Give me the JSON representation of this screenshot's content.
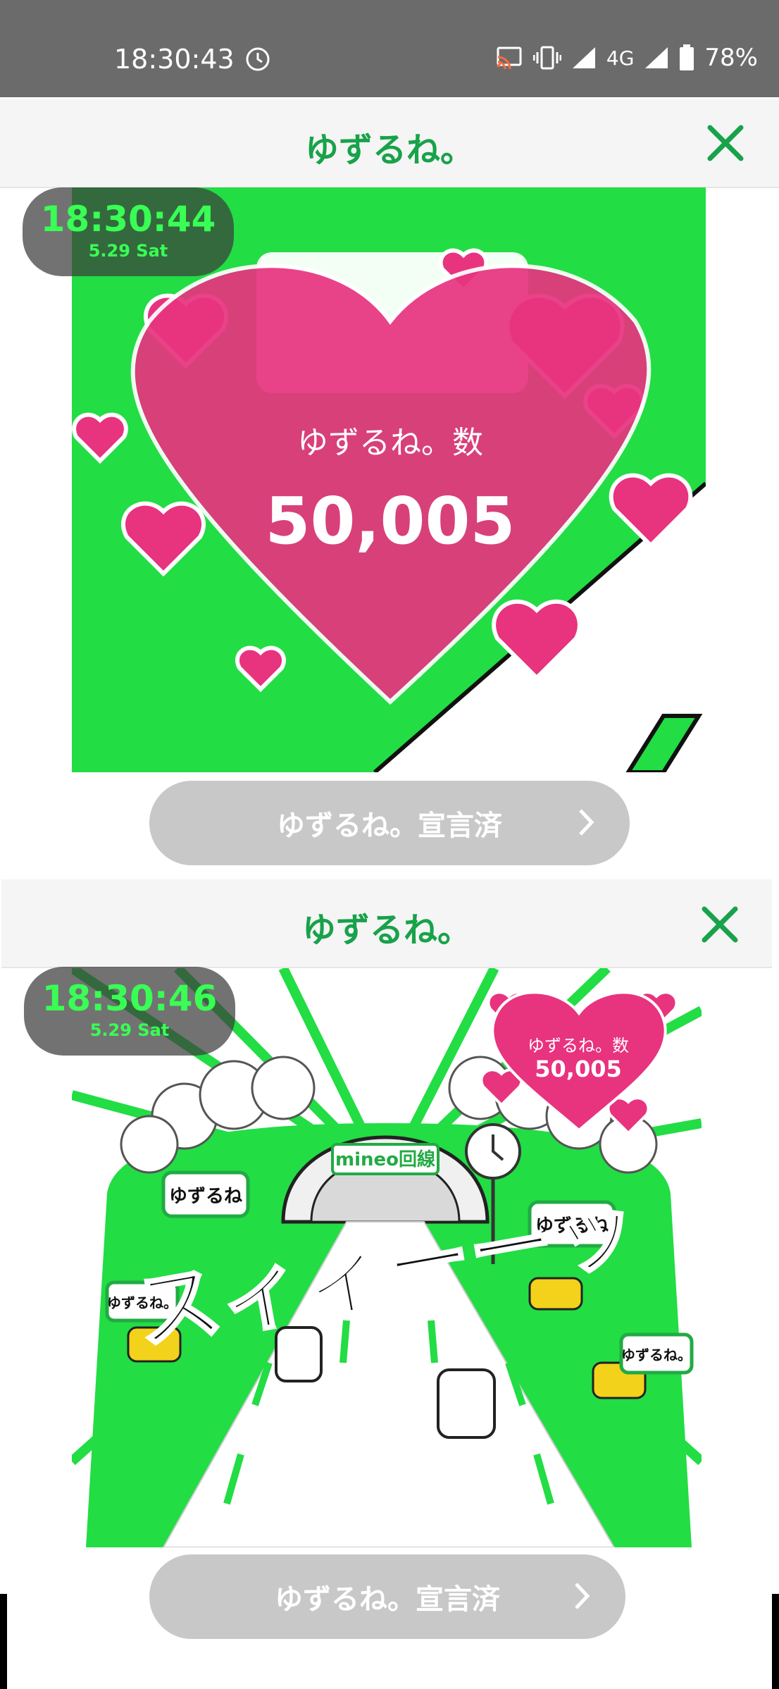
{
  "status_bar": {
    "time": "18:30:43",
    "network": "4G",
    "battery": "78%"
  },
  "modal1": {
    "title": "ゆずるね。",
    "count_label": "ゆずるね。数",
    "count_value": "50,005",
    "button_label": "ゆずるね。宣言済"
  },
  "modal2": {
    "title": "ゆずるね。",
    "count_label": "ゆずるね。数",
    "count_value": "50,005",
    "button_label": "ゆずるね。宣言済",
    "illustration": {
      "tunnel_sign": "mineo回線",
      "sfx_text": "スィィーーッ",
      "bubbles": [
        "ゆずるね",
        "ゆずるね",
        "ゆずるね。",
        "ゆずるね。"
      ]
    }
  },
  "clock_overlays": [
    {
      "time": "18:30:44",
      "date": "5.29 Sat"
    },
    {
      "time": "18:30:46",
      "date": "5.29 Sat"
    }
  ],
  "colors": {
    "brand_green": "#18a24a",
    "bright_green": "#22dd44",
    "heart_pink": "#e8337f",
    "button_gray": "#c8c8c8"
  }
}
